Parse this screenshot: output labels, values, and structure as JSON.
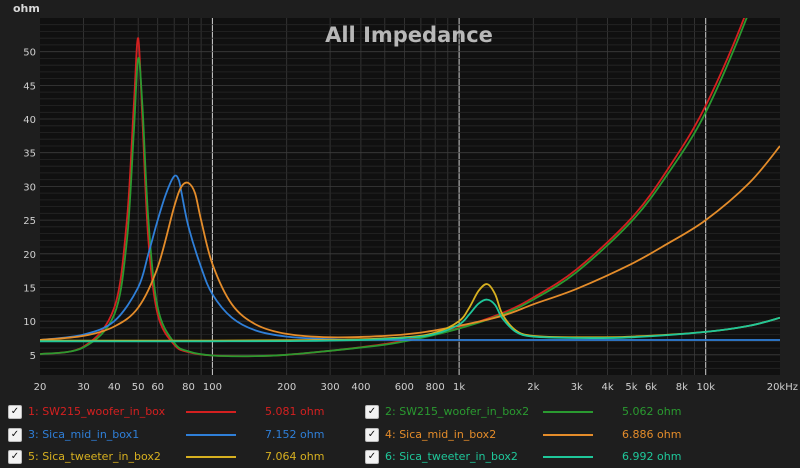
{
  "chart_data": {
    "type": "line",
    "title": "All Impedance",
    "ylabel": "ohm",
    "xscale": "log",
    "xlim": [
      20,
      20000
    ],
    "ylim": [
      2,
      55
    ],
    "x_ticks": [
      {
        "v": 20,
        "label": "20"
      },
      {
        "v": 30,
        "label": "30"
      },
      {
        "v": 40,
        "label": "40"
      },
      {
        "v": 50,
        "label": "50"
      },
      {
        "v": 60,
        "label": "60"
      },
      {
        "v": 80,
        "label": "80"
      },
      {
        "v": 100,
        "label": "100"
      },
      {
        "v": 200,
        "label": "200"
      },
      {
        "v": 300,
        "label": "300"
      },
      {
        "v": 400,
        "label": "400"
      },
      {
        "v": 600,
        "label": "600"
      },
      {
        "v": 800,
        "label": "800"
      },
      {
        "v": 1000,
        "label": "1k"
      },
      {
        "v": 2000,
        "label": "2k"
      },
      {
        "v": 3000,
        "label": "3k"
      },
      {
        "v": 4000,
        "label": "4k"
      },
      {
        "v": 5000,
        "label": "5k"
      },
      {
        "v": 6000,
        "label": "6k"
      },
      {
        "v": 8000,
        "label": "8k"
      },
      {
        "v": 10000,
        "label": "10k"
      },
      {
        "v": 20000,
        "label": "20kHz"
      }
    ],
    "y_ticks": [
      5,
      10,
      15,
      20,
      25,
      30,
      35,
      40,
      45,
      50
    ],
    "grid": true,
    "series": [
      {
        "name": "1: SW215_woofer_in_box",
        "color": "#d42020",
        "value_label": "5.081 ohm",
        "x": [
          20,
          30,
          40,
          45,
          48,
          50,
          52,
          55,
          60,
          70,
          80,
          100,
          150,
          200,
          300,
          500,
          700,
          1000,
          1500,
          2000,
          3000,
          5000,
          7000,
          10000,
          15000,
          20000
        ],
        "y": [
          5.1,
          6.2,
          12,
          25,
          42,
          52,
          40,
          22,
          11,
          6.5,
          5.4,
          4.9,
          4.8,
          5.0,
          5.6,
          6.6,
          7.6,
          9.0,
          11.2,
          13.5,
          17.7,
          25.3,
          32.5,
          42,
          57,
          72
        ]
      },
      {
        "name": "2: SW215_woofer_in_box2",
        "color": "#2a9a30",
        "value_label": "5.062 ohm",
        "x": [
          20,
          30,
          40,
          45,
          48,
          50,
          52,
          55,
          60,
          70,
          80,
          100,
          150,
          200,
          300,
          500,
          700,
          1000,
          1500,
          2000,
          3000,
          5000,
          7000,
          10000,
          15000,
          20000
        ],
        "y": [
          5.1,
          6.1,
          11,
          22,
          38,
          49,
          42,
          25,
          12,
          6.8,
          5.5,
          4.9,
          4.8,
          5.0,
          5.6,
          6.5,
          7.5,
          8.9,
          11.0,
          13.2,
          17.3,
          24.8,
          31.8,
          41,
          56,
          70
        ]
      },
      {
        "name": "3: Sica_mid_in_box1",
        "color": "#2f7fd8",
        "value_label": "7.152 ohm",
        "x": [
          20,
          30,
          40,
          50,
          55,
          60,
          65,
          70,
          73,
          75,
          80,
          90,
          100,
          120,
          150,
          200,
          300,
          400,
          600,
          1000,
          1300,
          2000,
          5000,
          10000,
          20000
        ],
        "y": [
          7.2,
          8.0,
          10,
          15,
          20,
          25,
          29,
          31.5,
          31,
          29,
          24,
          18,
          14,
          10.5,
          8.6,
          7.7,
          7.3,
          7.2,
          7.2,
          7.2,
          7.2,
          7.2,
          7.2,
          7.2,
          7.2
        ]
      },
      {
        "name": "4: Sica_mid_in_box2",
        "color": "#e48c2a",
        "value_label": "6.886 ohm",
        "x": [
          20,
          30,
          40,
          50,
          60,
          70,
          75,
          80,
          85,
          90,
          100,
          120,
          150,
          200,
          300,
          500,
          700,
          1000,
          1500,
          2000,
          3000,
          5000,
          7000,
          10000,
          15000,
          20000
        ],
        "y": [
          7.2,
          7.8,
          9.2,
          12,
          18,
          27,
          30,
          30.5,
          29,
          25,
          18.5,
          12.5,
          9.5,
          8.1,
          7.6,
          7.8,
          8.3,
          9.3,
          10.8,
          12.5,
          14.8,
          18.5,
          21.5,
          25,
          30.5,
          36
        ]
      },
      {
        "name": "5: Sica_tweeter_in_box2",
        "color": "#d7b020",
        "value_label": "7.064 ohm",
        "x": [
          20,
          100,
          300,
          600,
          800,
          1000,
          1100,
          1200,
          1300,
          1400,
          1500,
          1700,
          2000,
          3000,
          5000,
          10000,
          15000,
          20000
        ],
        "y": [
          7.1,
          7.1,
          7.2,
          7.6,
          8.3,
          10.0,
          12.0,
          14.5,
          15.5,
          14.0,
          11.0,
          8.6,
          7.8,
          7.6,
          7.7,
          8.4,
          9.3,
          10.5
        ]
      },
      {
        "name": "6: Sica_tweeter_in_box2",
        "color": "#1fc79a",
        "value_label": "6.992 ohm",
        "x": [
          20,
          100,
          300,
          600,
          800,
          1000,
          1100,
          1200,
          1300,
          1400,
          1500,
          1700,
          2000,
          3000,
          5000,
          10000,
          15000,
          20000
        ],
        "y": [
          7.0,
          7.0,
          7.1,
          7.5,
          8.1,
          9.5,
          11.0,
          12.6,
          13.2,
          12.4,
          10.4,
          8.4,
          7.7,
          7.5,
          7.6,
          8.4,
          9.3,
          10.5
        ]
      }
    ]
  }
}
